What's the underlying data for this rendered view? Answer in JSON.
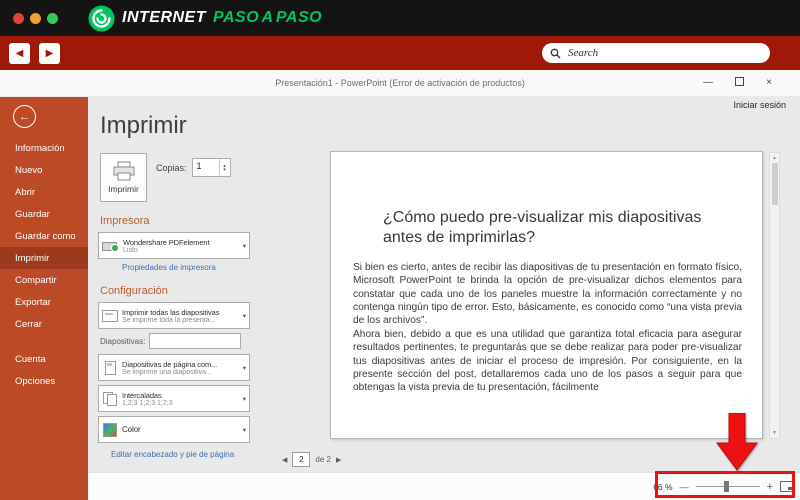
{
  "colors": {
    "topbar": "#141414",
    "brand-green": "#00c45c",
    "nav-red": "#9f1808",
    "backstage": "#bc4a27",
    "backstage-active": "#9e3a1c",
    "heading-orange": "#c25a2b",
    "link-blue": "#3d6eb5",
    "annotation-red": "#ee1111",
    "dot-red": "#e0443a",
    "dot-amber": "#efa032",
    "dot-green": "#33cc5a"
  },
  "branding": {
    "logo_white": "INTERNET",
    "logo_green": "PASO A PASO"
  },
  "browser": {
    "search_placeholder": "Search"
  },
  "icons": {
    "back": "◀",
    "forward": "▶",
    "minimize": "—",
    "close": "×",
    "back_arrow": "←",
    "caret": "▾",
    "spin_up": "▴",
    "spin_down": "▾",
    "scroll_up": "▲",
    "scroll_down": "▼",
    "page_prev": "◀",
    "page_next": "▶",
    "minus": "—",
    "plus": "+"
  },
  "titlebar": {
    "title": "Presentación1 - PowerPoint (Error de activación de productos)",
    "sign_in": "Iniciar sesión"
  },
  "sidebar": {
    "items": [
      {
        "label": "Información"
      },
      {
        "label": "Nuevo"
      },
      {
        "label": "Abrir"
      },
      {
        "label": "Guardar"
      },
      {
        "label": "Guardar como"
      },
      {
        "label": "Imprimir"
      },
      {
        "label": "Compartir"
      },
      {
        "label": "Exportar"
      },
      {
        "label": "Cerrar"
      },
      {
        "label": "Cuenta"
      },
      {
        "label": "Opciones"
      }
    ]
  },
  "print": {
    "title": "Imprimir",
    "print_button_label": "Imprimir",
    "copies_label": "Copias:",
    "copies_value": "1",
    "printer_heading": "Impresora",
    "printer_name": "Wondershare PDFelement",
    "printer_status": "Listo",
    "printer_properties": "Propiedades de impresora",
    "settings_heading": "Configuración",
    "settings": [
      {
        "title": "Imprimir todas las diapositivas",
        "sub": "Se imprime toda la presenta..."
      },
      {
        "title": "Diapositivas de página com...",
        "sub": "Se imprime una diapositiva..."
      },
      {
        "title": "Intercaladas",
        "sub": "1;2;3  1;2;3  1;2;3"
      },
      {
        "title": "Color",
        "sub": ""
      }
    ],
    "slides_label": "Diapositivas:",
    "edit_link": "Editar encabezado y pie de página"
  },
  "slide": {
    "title": "¿Cómo puedo pre-visualizar mis diapositivas antes de imprimirlas?",
    "paragraphs": [
      "Si bien es cierto, antes de recibir las diapositivas de tu presentación en formato físico, Microsoft PowerPoint te brinda la opción de pre-visualizar dichos elementos para constatar que cada uno de los paneles muestre la información correctamente y no contenga ningún tipo de error. Esto, básicamente, es conocido como “una vista previa de los archivos”.",
      "Ahora bien, debido a que es una utilidad que garantiza total eficacia para asegurar resultados pertinentes, te preguntarás que se debe realizar para poder pre-visualizar tus diapositivas antes de iniciar el proceso de impresión. Por consiguiente, en la presente sección del post, detallaremos cada uno de los pasos a seguir para que obtengas la vista previa de tu presentación, fácilmente"
    ]
  },
  "statusbar": {
    "page_current": "2",
    "page_total": "de 2",
    "zoom_value": "66 %"
  }
}
